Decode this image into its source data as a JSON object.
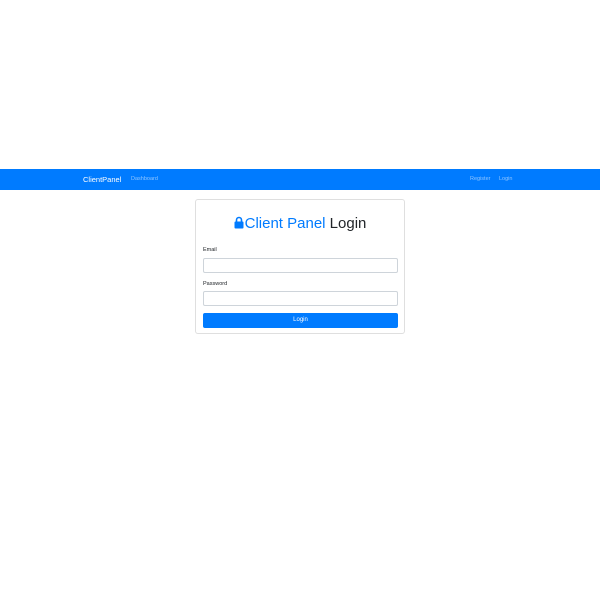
{
  "navbar": {
    "brand": "ClientPanel",
    "links": {
      "dashboard": "Dashboard",
      "register": "Register",
      "login": "Login"
    },
    "background_color": "#007bff"
  },
  "login_card": {
    "icon": "lock-icon",
    "title_accent": "Client Panel",
    "title_rest": "Login",
    "accent_color": "#007bff",
    "email": {
      "label": "Email",
      "value": "",
      "placeholder": ""
    },
    "password": {
      "label": "Password",
      "value": "",
      "placeholder": ""
    },
    "submit_label": "Login"
  }
}
